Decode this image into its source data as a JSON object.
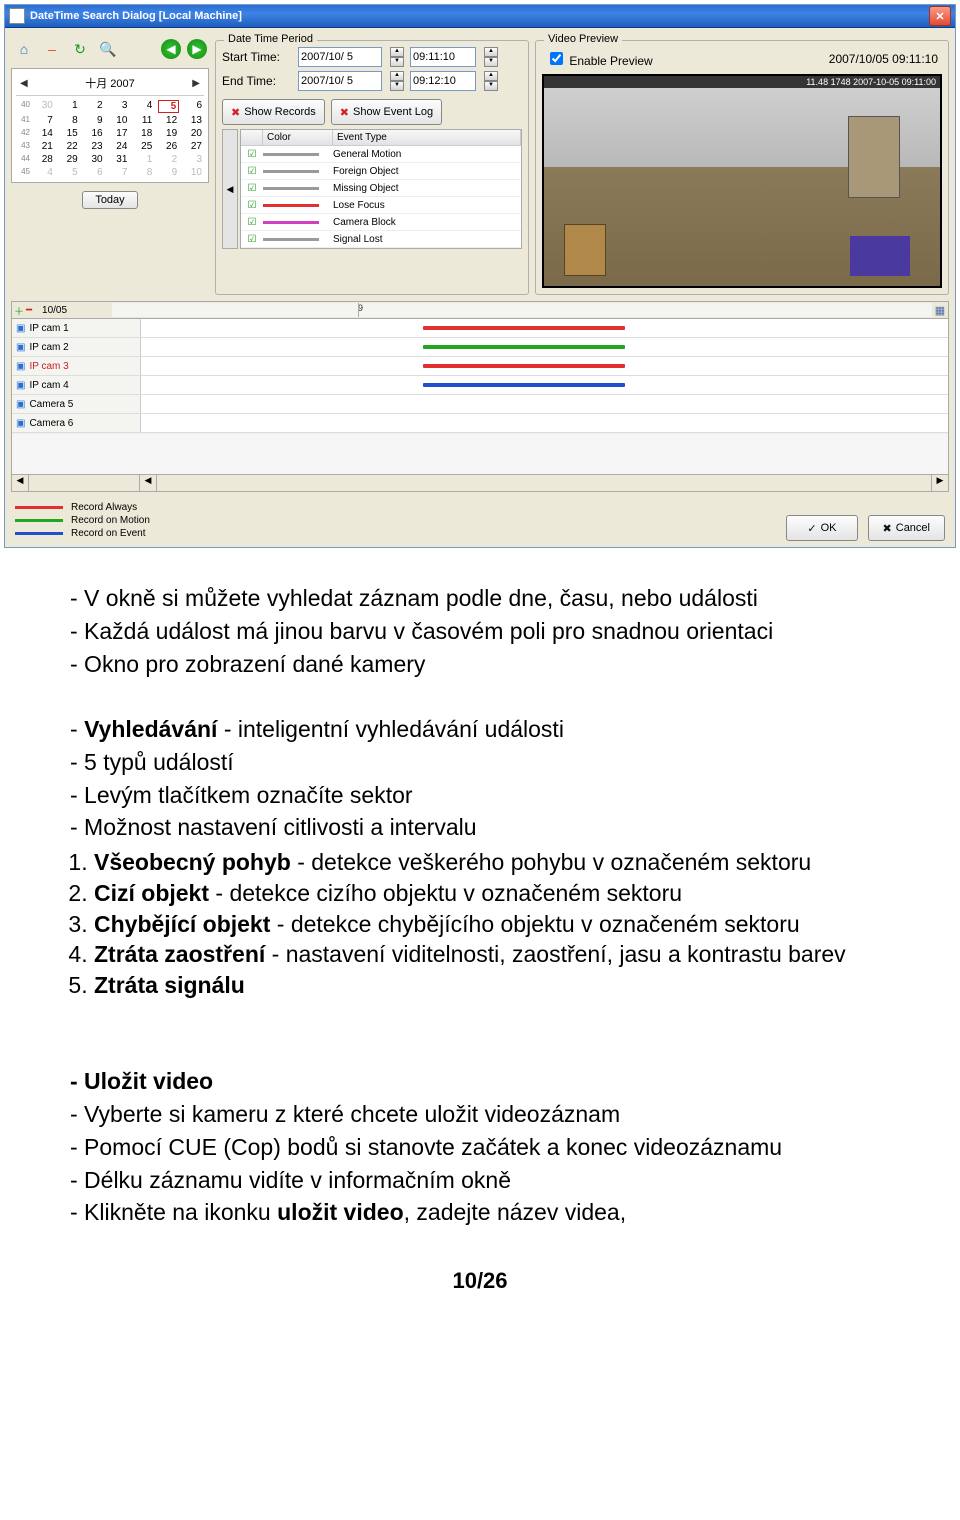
{
  "dialog": {
    "title": "DateTime Search Dialog  [Local Machine]",
    "datetime_period": {
      "legend": "Date Time Period",
      "start_label": "Start Time:",
      "start_date": "2007/10/ 5",
      "start_time": "09:11:10",
      "end_label": "End Time:",
      "end_date": "2007/10/ 5",
      "end_time": "09:12:10"
    },
    "buttons": {
      "show_records": "Show Records",
      "show_event_log": "Show Event Log",
      "ok": "OK",
      "cancel": "Cancel",
      "today": "Today"
    },
    "calendar": {
      "month_label": "十月 2007",
      "weeks": [
        "40",
        "41",
        "42",
        "43",
        "44",
        "45"
      ],
      "days": [
        [
          "30",
          "1",
          "2",
          "3",
          "4",
          "5",
          "6"
        ],
        [
          "7",
          "8",
          "9",
          "10",
          "11",
          "12",
          "13"
        ],
        [
          "14",
          "15",
          "16",
          "17",
          "18",
          "19",
          "20"
        ],
        [
          "21",
          "22",
          "23",
          "24",
          "25",
          "26",
          "27"
        ],
        [
          "28",
          "29",
          "30",
          "31",
          "1",
          "2",
          "3"
        ],
        [
          "4",
          "5",
          "6",
          "7",
          "8",
          "9",
          "10"
        ]
      ],
      "today_day": "5"
    },
    "event_table": {
      "col_color": "Color",
      "col_type": "Event Type",
      "rows": [
        {
          "color": "#9a9a9a",
          "label": "General Motion"
        },
        {
          "color": "#9a9a9a",
          "label": "Foreign Object"
        },
        {
          "color": "#9a9a9a",
          "label": "Missing Object"
        },
        {
          "color": "#e03030",
          "label": "Lose Focus"
        },
        {
          "color": "#d040c0",
          "label": "Camera Block"
        },
        {
          "color": "#9a9a9a",
          "label": "Signal Lost"
        }
      ]
    },
    "preview": {
      "legend": "Video Preview",
      "enable_label": "Enable Preview",
      "timestamp": "2007/10/05 09:11:10",
      "overlay": "11.48  1748 2007-10-05 09:11:00"
    },
    "timeline": {
      "date_label": "10/05",
      "hour_label": "9",
      "cameras": [
        {
          "name": "IP cam 1",
          "color": "#e03030",
          "highlight": false
        },
        {
          "name": "IP cam 2",
          "color": "#21a621",
          "highlight": false
        },
        {
          "name": "IP cam 3",
          "color": "#e03030",
          "highlight": true
        },
        {
          "name": "IP cam 4",
          "color": "#2050d0",
          "highlight": false
        },
        {
          "name": "Camera 5",
          "color": null,
          "highlight": false
        },
        {
          "name": "Camera 6",
          "color": null,
          "highlight": false
        }
      ]
    },
    "record_legend": {
      "always": {
        "color": "#e03030",
        "label": "Record Always"
      },
      "motion": {
        "color": "#21a621",
        "label": "Record on Motion"
      },
      "event": {
        "color": "#2050d0",
        "label": "Record on Event"
      }
    }
  },
  "doc": {
    "p1": "- V okně si můžete vyhledat záznam podle dne, času, nebo události",
    "p2": "- Každá událost má jinou barvu v časovém poli pro snadnou orientaci",
    "p3": "- Okno pro zobrazení dané kamery",
    "p4a": "- ",
    "p4b": "Vyhledávání",
    "p4c": "  - inteligentní vyhledávání události",
    "p5": "- 5 typů událostí",
    "p6": "- Levým tlačítkem označíte sektor",
    "p7": "- Možnost nastavení citlivosti a intervalu",
    "li1a": "Všeobecný pohyb",
    "li1b": " - detekce veškerého pohybu v označeném sektoru",
    "li2a": "Cizí objekt",
    "li2b": " - detekce cizího objektu v označeném sektoru",
    "li3a": "Chybějící objekt",
    "li3b": " - detekce chybějícího objektu v označeném sektoru",
    "li4a": "Ztráta zaostření",
    "li4b": " - nastavení viditelnosti, zaostření, jasu a kontrastu barev",
    "li5a": "Ztráta signálu",
    "save1": "- Uložit video",
    "save2": "- Vyberte si kameru z které chcete uložit videozáznam",
    "save3": "- Pomocí CUE (Cop) bodů si stanovte začátek a konec videozáznamu",
    "save4": "- Délku záznamu vidíte v informačním okně",
    "save5a": "- Klikněte na ikonku ",
    "save5b": "uložit video",
    "save5c": ", zadejte název videa,",
    "page": "10/26"
  }
}
